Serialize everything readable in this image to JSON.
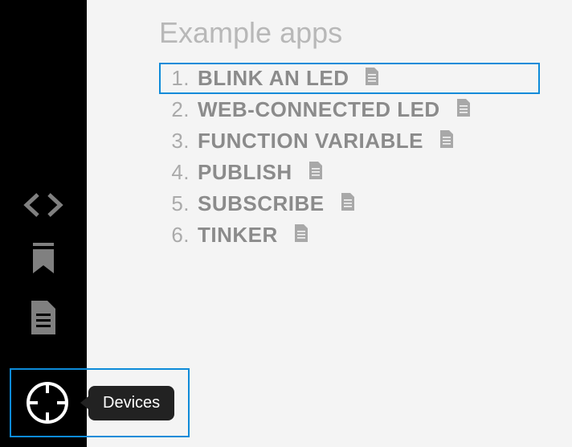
{
  "pageTitle": "Example apps",
  "apps": [
    {
      "num": "1.",
      "name": "BLINK AN LED",
      "selected": true
    },
    {
      "num": "2.",
      "name": "WEB-CONNECTED LED",
      "selected": false
    },
    {
      "num": "3.",
      "name": "FUNCTION VARIABLE",
      "selected": false
    },
    {
      "num": "4.",
      "name": "PUBLISH",
      "selected": false
    },
    {
      "num": "5.",
      "name": "SUBSCRIBE",
      "selected": false
    },
    {
      "num": "6.",
      "name": "TINKER",
      "selected": false
    }
  ],
  "tooltip": {
    "devices": "Devices"
  },
  "colors": {
    "accent": "#0d8bd9",
    "sidebar": "#000000",
    "text": "#8b8b8b",
    "muted": "#b8b8b8"
  },
  "icons": {
    "code": "code-icon",
    "bookmark": "bookmark-icon",
    "file": "file-icon",
    "target": "target-icon"
  }
}
